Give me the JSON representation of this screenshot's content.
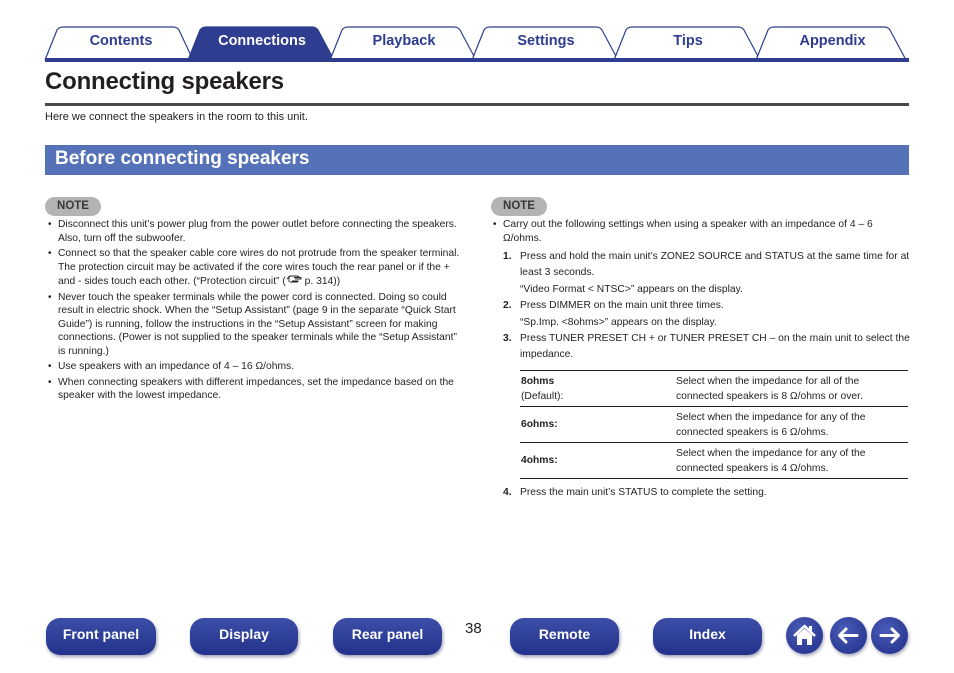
{
  "colors": {
    "brand_navy": "#2e3d8f",
    "section_blue": "#5571b8",
    "note_gray": "#b3b3b3",
    "text": "#231f20"
  },
  "tabs": [
    {
      "label": "Contents",
      "active": false
    },
    {
      "label": "Connections",
      "active": true
    },
    {
      "label": "Playback",
      "active": false
    },
    {
      "label": "Settings",
      "active": false
    },
    {
      "label": "Tips",
      "active": false
    },
    {
      "label": "Appendix",
      "active": false
    }
  ],
  "page": {
    "title": "Connecting speakers",
    "intro": "Here we connect the speakers in the room to this unit.",
    "section_title": "Before connecting speakers"
  },
  "left_note": {
    "badge": "NOTE",
    "items": [
      "Disconnect this unit’s power plug from the power outlet before connecting the speakers. Also, turn off the subwoofer.",
      "Connect so that the speaker cable core wires do not protrude from the speaker terminal. The protection circuit may be activated if the core wires touch the rear panel or if the + and - sides touch each other. (“Protection circuit” (",
      "Never touch the speaker terminals while the power cord is connected. Doing so could result in electric shock. When the “Setup Assistant” (page 9 in the separate “Quick Start Guide”) is running, follow the instructions in the “Setup Assistant” screen for making connections. (Power is not supplied to the speaker terminals while the “Setup Assistant” is running.)",
      "Use speakers with an impedance of 4 – 16 Ω/ohms.",
      "When connecting speakers with different impedances, set the impedance based on the speaker with the lowest impedance."
    ],
    "item2_ref_icon": "pointing-hand-icon",
    "item2_ref_tail": " p. 314))"
  },
  "right_note": {
    "badge": "NOTE",
    "intro": "Carry out the following settings when using a speaker with an impedance of 4 – 6 Ω/ohms.",
    "steps": [
      {
        "num": "1.",
        "text": "Press and hold the main unit’s ZONE2 SOURCE and STATUS at the same time for at least 3 seconds.",
        "sub": "“Video Format < NTSC>” appears on the display."
      },
      {
        "num": "2.",
        "text": "Press DIMMER on the main unit three times.",
        "sub": "“Sp.Imp. <8ohms>” appears on the display."
      },
      {
        "num": "3.",
        "text": "Press TUNER PRESET CH + or TUNER PRESET CH – on the main unit to select the impedance.",
        "sub": ""
      },
      {
        "num": "4.",
        "text": "Press the main unit’s STATUS to complete the setting.",
        "sub": ""
      }
    ],
    "table": [
      {
        "key": "8ohms",
        "key_note": "(Default):",
        "value": "Select when the impedance for all of the connected speakers is 8 Ω/ohms or over."
      },
      {
        "key": "6ohms:",
        "key_note": "",
        "value": "Select when the impedance for any of the connected speakers is 6 Ω/ohms."
      },
      {
        "key": "4ohms:",
        "key_note": "",
        "value": "Select when the impedance for any of the connected speakers is 4 Ω/ohms."
      }
    ]
  },
  "footer": {
    "buttons": [
      "Front panel",
      "Display",
      "Rear panel",
      "Remote",
      "Index"
    ],
    "page_number": "38",
    "icons": [
      "home-icon",
      "back-arrow-icon",
      "forward-arrow-icon"
    ]
  }
}
